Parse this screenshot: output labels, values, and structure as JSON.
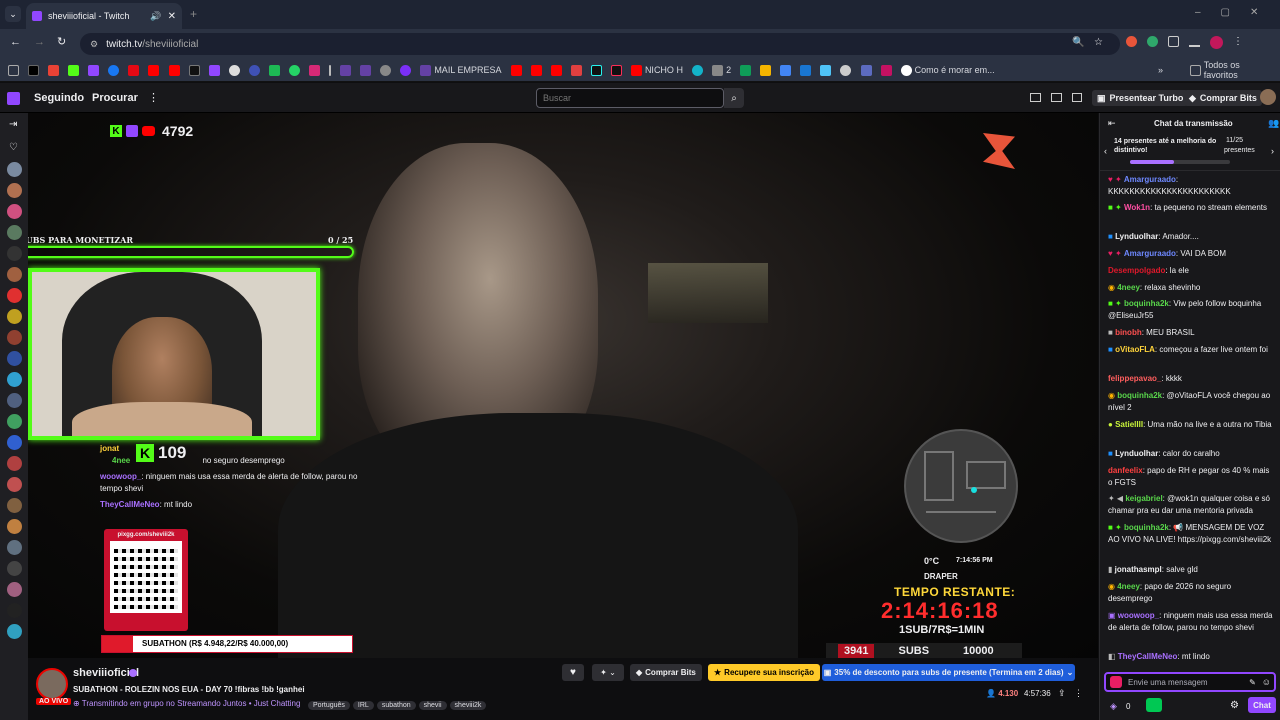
{
  "browser": {
    "tab_title": "sheviiioficial - Twitch",
    "url_host": "twitch.tv",
    "url_path": "/sheviiioficial",
    "bookmarks": [
      "MAIL EMPRESA",
      "NICHO H",
      "2",
      "Como é morar em...",
      "Todos os favoritos"
    ]
  },
  "nav": {
    "following": "Seguindo",
    "browse": "Procurar",
    "search_placeholder": "Buscar",
    "turbo": "Presentear Turbo",
    "buy_bits": "Comprar Bits"
  },
  "overlay": {
    "viewer_count": "4792",
    "subs_title": "SUBS PARA MONETIZAR",
    "subs_progress": "0 / 25",
    "subs_fraction": 0.0,
    "kick_count": "109",
    "qr_label": "pixgg.com/sheviii2k",
    "subathon": "SUBATHON (R$ 4.948,22/R$ 40.000,00)",
    "subathon_fraction": 0.124,
    "temp": "0°C",
    "time": "7:14:56 PM",
    "place": "DRAPER",
    "timer_label": "TEMPO RESTANTE:",
    "timer": "2:14:16:18",
    "rate": "1SUB/7R$=1MIN",
    "subs_current": "3941",
    "subs_word": "SUBS",
    "subs_goal": "10000",
    "mini_chat": [
      {
        "user": "jonat",
        "text": ""
      },
      {
        "user": "4nee",
        "text": "no seguro desemprego"
      },
      {
        "user": "woowoop_",
        "text": ": ninguem mais usa essa merda de alerta de follow, parou no tempo shevi"
      },
      {
        "user": "TheyCallMeNeo",
        "text": ": mt lindo"
      }
    ]
  },
  "chat": {
    "header": "Chat da transmissão",
    "gift_banner": "14 presentes até a melhoria do distintivo!",
    "gift_count": "11/25",
    "gift_word": "presentes",
    "messages": [
      {
        "user": "Amarguraado",
        "color": "#6e88ff",
        "text": "KKKKKKKKKKKKKKKKKKKKKKK"
      },
      {
        "user": "Wok1n",
        "color": "#ff4fa3",
        "text": "ta pequeno no stream elements"
      },
      {
        "user": "Lynduolhar",
        "color": "#ffffff",
        "text": "Amador...."
      },
      {
        "user": "Amarguraado",
        "color": "#6e88ff",
        "text": "VAI DA BOM"
      },
      {
        "user": "Desempolgado",
        "color": "#e0182b",
        "text": "la ele"
      },
      {
        "user": "4neey",
        "color": "#59d64b",
        "text": "relaxa shevinho"
      },
      {
        "user": "boquinha2k",
        "color": "#59d64b",
        "text": "Viw pelo follow boquinha @EliseuJr55"
      },
      {
        "user": "binobh",
        "color": "#ff5050",
        "text": "MEU BRASIL"
      },
      {
        "user": "oVitaoFLA",
        "color": "#ffd43b",
        "text": "começou a fazer live ontem foi"
      },
      {
        "user": "felippepavao_",
        "color": "#ff5e5e",
        "text": "kkkk"
      },
      {
        "user": "boquinha2k",
        "color": "#59d64b",
        "text": "@oVitaoFLA você chegou ao nível 2"
      },
      {
        "user": "SatielIII",
        "color": "#c8f33a",
        "text": "Uma mão na live e a outra no Tibia"
      },
      {
        "user": "Lynduolhar",
        "color": "#ffffff",
        "text": "calor do caralho"
      },
      {
        "user": "danfeelix",
        "color": "#ff4040",
        "text": "papo de RH e pegar os 40 % mais o FGTS"
      },
      {
        "user": "keigabriel",
        "color": "#59d64b",
        "text": "@wok1n qualquer coisa e só chamar pra eu dar uma mentoria privada"
      },
      {
        "user": "boquinha2k",
        "color": "#59d64b",
        "text": "📢 MENSAGEM DE VOZ AO VIVO NA LIVE! https://pixgg.com/sheviii2k"
      },
      {
        "user": "jonathasmpl",
        "color": "#ffffff",
        "text": "salve gld"
      },
      {
        "user": "4neey",
        "color": "#59d64b",
        "text": "papo de 2026 no seguro desemprego"
      },
      {
        "user": "woowoop_",
        "color": "#a970ff",
        "text": "ninguem mais usa essa merda de alerta de follow, parou no tempo shevi"
      },
      {
        "user": "TheyCallMeNeo",
        "color": "#a970ff",
        "text": "mt lindo"
      }
    ],
    "input_placeholder": "Envie uma mensagem",
    "points": "0",
    "send": "Chat"
  },
  "stream": {
    "channel": "sheviiioficial",
    "live": "AO VIVO",
    "title": "SUBATHON - ROLEZIN NOS EUA - DAY 70 !fibras !bb !ganhei",
    "group": "Transmitindo em grupo no Streamando Juntos",
    "category": "Just Chatting",
    "tags": [
      "Português",
      "IRL",
      "subathon",
      "shevii",
      "sheviii2k"
    ],
    "buy_bits": "Comprar Bits",
    "resub": "Recupere sua inscrição",
    "discount": "35% de desconto para subs de presente (Termina em 2 dias)",
    "viewers": "4.130",
    "uptime": "4:57:36"
  },
  "colors": {
    "accent": "#9147ff",
    "live": "#eb0400",
    "kick": "#53fc18",
    "timer_red": "#ff2d2d",
    "timer_yellow": "#ffd83a"
  }
}
